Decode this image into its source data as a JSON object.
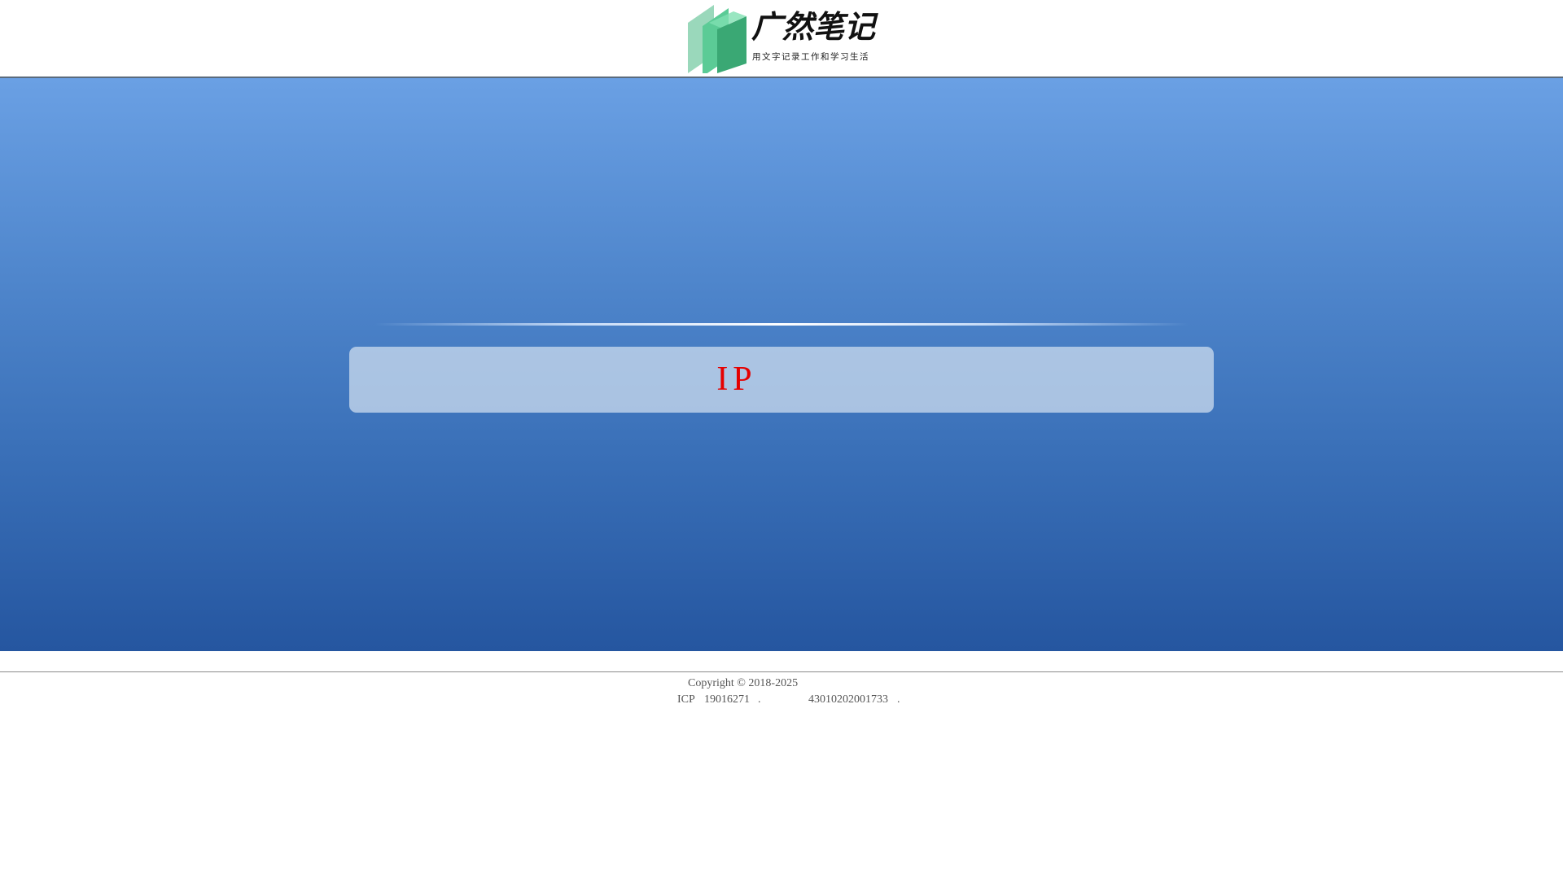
{
  "header": {
    "logo": {
      "title": "广然笔记",
      "slogan": "用文字记录工作和学习生活",
      "colors": {
        "light_green": "#8fd3b3",
        "mid_green": "#4cc48d",
        "dark_green": "#35ad77"
      }
    }
  },
  "hero": {
    "notice_text": "IP",
    "notice_color": "#e50000",
    "gradient_top": "#6aa0e4",
    "gradient_bottom": "#2556a0"
  },
  "footer": {
    "copyright": "Copyright © 2018-2025",
    "icp_label": "ICP",
    "icp_number": "19016271",
    "dot": ".",
    "psb_number": "43010202001733"
  }
}
